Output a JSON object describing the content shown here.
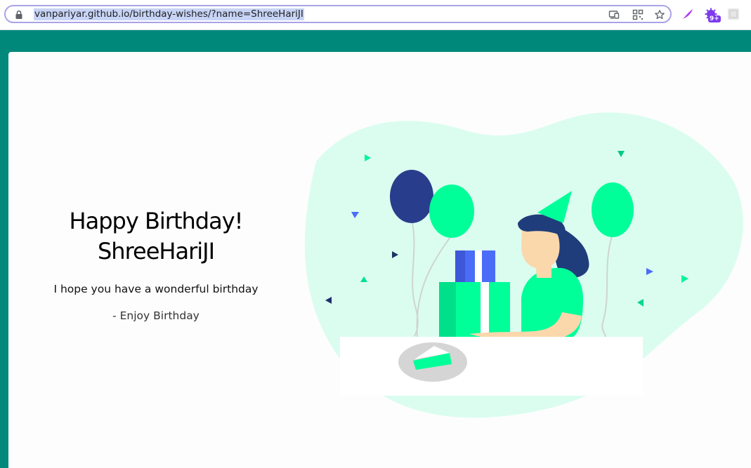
{
  "browser": {
    "url": "vanpariyar.github.io/birthday-wishes/?name=ShreeHariJI",
    "extension_badge": "9+"
  },
  "colors": {
    "page_background": "#00897b",
    "card_background": "#fdfdfd",
    "blob": "#d9fdee",
    "accent_green": "#00ff99",
    "navy": "#283d8c",
    "blue": "#4a6cf7"
  },
  "greeting": {
    "line1": "Happy Birthday!",
    "line2": "ShreeHariJI",
    "message": "I hope you have a wonderful birthday",
    "signature": "- Enjoy Birthday"
  },
  "icons": [
    "lock-icon",
    "cast-icon",
    "qr-code-icon",
    "bookmark-star-icon",
    "feather-extension-icon",
    "puzzle-extension-icon",
    "profile-extension-icon"
  ]
}
